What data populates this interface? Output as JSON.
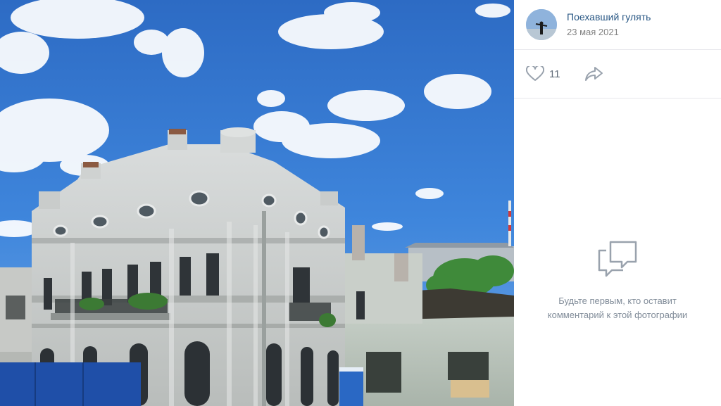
{
  "post": {
    "author_name": "Поехавший гулять",
    "date": "23 мая 2021",
    "likes": "11"
  },
  "icons": {
    "like": "heart-icon",
    "share": "share-arrow-icon",
    "comments_empty": "speech-bubbles-icon"
  },
  "comments": {
    "empty_text": "Будьте первым, кто оставит\nкомментарий к этой фотографии"
  },
  "colors": {
    "link": "#2a5885",
    "muted": "#828282",
    "icon": "#99a2ad",
    "divider": "#e7e8ec"
  }
}
